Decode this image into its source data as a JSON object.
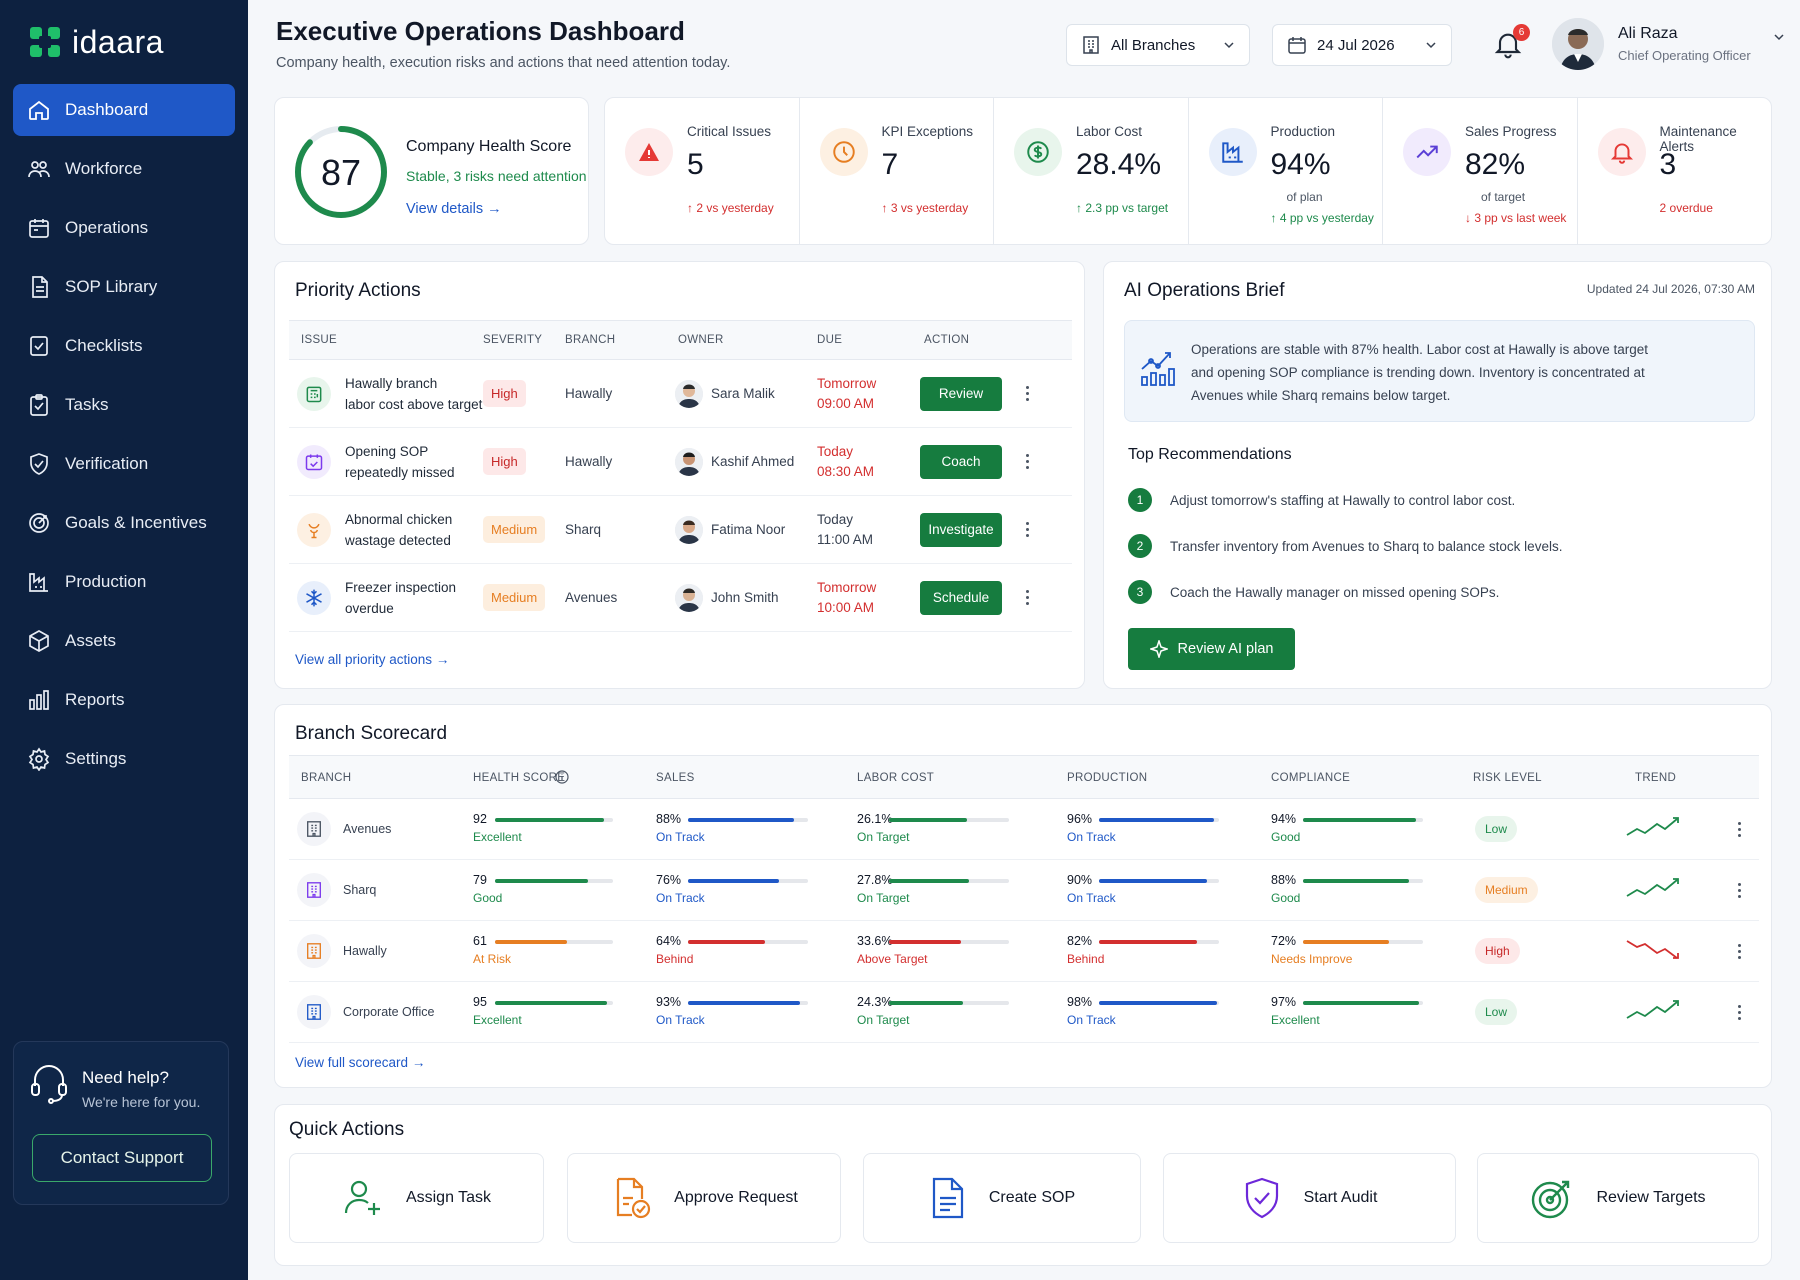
{
  "brand": {
    "name": "idaara"
  },
  "nav": [
    {
      "label": "Dashboard",
      "icon": "home-icon"
    },
    {
      "label": "Workforce",
      "icon": "people-icon"
    },
    {
      "label": "Operations",
      "icon": "calendar-icon"
    },
    {
      "label": "SOP Library",
      "icon": "document-icon"
    },
    {
      "label": "Checklists",
      "icon": "checklist-icon"
    },
    {
      "label": "Tasks",
      "icon": "clipboard-icon"
    },
    {
      "label": "Verification",
      "icon": "shield-check-icon"
    },
    {
      "label": "Goals & Incentives",
      "icon": "target-icon"
    },
    {
      "label": "Production",
      "icon": "factory-icon"
    },
    {
      "label": "Assets",
      "icon": "cube-icon"
    },
    {
      "label": "Reports",
      "icon": "bar-chart-icon"
    },
    {
      "label": "Settings",
      "icon": "gear-icon"
    }
  ],
  "help": {
    "title": "Need help?",
    "subtitle": "We're here for you.",
    "button": "Contact Support"
  },
  "header": {
    "title": "Executive Operations Dashboard",
    "subtitle": "Company health, execution risks and actions that need attention today.",
    "branch_select": "All Branches",
    "date_select": "24 Jul 2026",
    "notification_count": "6",
    "user_name": "Ali Raza",
    "user_role": "Chief Operating Officer"
  },
  "health": {
    "score": "87",
    "score_value": 87,
    "title": "Company Health Score",
    "status": "Stable, 3 risks need attention",
    "link": "View details"
  },
  "kpis": [
    {
      "label": "Critical Issues",
      "value": "5",
      "sub": "",
      "delta_num": "2",
      "delta_text": "vs yesterday",
      "dir": "up",
      "tone": "red",
      "icon": "warning-icon"
    },
    {
      "label": "KPI Exceptions",
      "value": "7",
      "sub": "",
      "delta_num": "3",
      "delta_text": "vs yesterday",
      "dir": "up",
      "tone": "red",
      "icon": "clock-icon"
    },
    {
      "label": "Labor Cost",
      "value": "28.4%",
      "sub": "",
      "delta_num": "2.3",
      "delta_text": "pp vs target",
      "dir": "up",
      "tone": "green",
      "icon": "dollar-icon"
    },
    {
      "label": "Production",
      "value": "94%",
      "sub": "of plan",
      "delta_num": "4",
      "delta_text": "pp vs yesterday",
      "dir": "up",
      "tone": "green",
      "icon": "factory-icon"
    },
    {
      "label": "Sales Progress",
      "value": "82%",
      "sub": "of target",
      "delta_num": "3",
      "delta_text": "pp vs last week",
      "dir": "down",
      "tone": "red",
      "icon": "trend-up-icon"
    },
    {
      "label": "Maintenance Alerts",
      "value": "3",
      "sub": "",
      "delta_num": "2",
      "delta_text": "overdue",
      "dir": "none",
      "tone": "red",
      "icon": "bell-alert-icon"
    }
  ],
  "priority": {
    "title": "Priority Actions",
    "headers": [
      "ISSUE",
      "SEVERITY",
      "BRANCH",
      "OWNER",
      "DUE",
      "ACTION"
    ],
    "rows": [
      {
        "issue_line1": "Hawally branch",
        "issue_line2": "labor cost above target",
        "severity": "High",
        "branch": "Hawally",
        "owner": "Sara Malik",
        "due_line1": "Tomorrow",
        "due_line2": "09:00 AM",
        "due_urgent": true,
        "action": "Review",
        "icon": "cash-register-icon",
        "icon_color": "#1e8a4c"
      },
      {
        "issue_line1": "Opening SOP",
        "issue_line2": "repeatedly missed",
        "severity": "High",
        "branch": "Hawally",
        "owner": "Kashif Ahmed",
        "due_line1": "Today",
        "due_line2": "08:30 AM",
        "due_urgent": true,
        "action": "Coach",
        "icon": "calendar-check-icon",
        "icon_color": "#7c3aed"
      },
      {
        "issue_line1": "Abnormal chicken",
        "issue_line2": "wastage detected",
        "severity": "Medium",
        "branch": "Sharq",
        "owner": "Fatima Noor",
        "due_line1": "Today",
        "due_line2": "11:00 AM",
        "due_urgent": false,
        "action": "Investigate",
        "icon": "chicken-icon",
        "icon_color": "#e67e22"
      },
      {
        "issue_line1": "Freezer inspection",
        "issue_line2": "overdue",
        "severity": "Medium",
        "branch": "Avenues",
        "owner": "John Smith",
        "due_line1": "Tomorrow",
        "due_line2": "10:00 AM",
        "due_urgent": true,
        "action": "Schedule",
        "icon": "snowflake-icon",
        "icon_color": "#1f58c7"
      }
    ],
    "link": "View all priority actions"
  },
  "brief": {
    "title": "AI Operations Brief",
    "updated": "Updated 24 Jul 2026, 07:30 AM",
    "text": "Operations are stable with 87% health. Labor cost at Hawally is above target and opening SOP compliance is trending down. Inventory is concentrated at Avenues while Sharq remains below target.",
    "rec_title": "Top Recommendations",
    "recs": [
      "Adjust tomorrow's staffing at Hawally to control labor cost.",
      "Transfer inventory from Avenues to Sharq to balance stock levels.",
      "Coach the Hawally manager on missed opening SOPs."
    ],
    "button": "Review AI plan"
  },
  "scorecard": {
    "title": "Branch Scorecard",
    "headers": [
      "BRANCH",
      "HEALTH SCORE",
      "SALES",
      "LABOR COST",
      "PRODUCTION",
      "COMPLIANCE",
      "RISK LEVEL",
      "TREND"
    ],
    "rows": [
      {
        "branch": "Avenues",
        "icon_color": "#4b5563",
        "health": "92",
        "health_pct": 92,
        "health_status": "Excellent",
        "health_tone": "green",
        "sales": "88%",
        "sales_pct": 88,
        "sales_status": "On Track",
        "sales_tone": "blue",
        "labor": "26.1%",
        "labor_pct": 65,
        "labor_status": "On Target",
        "labor_tone": "green",
        "prod": "96%",
        "prod_pct": 96,
        "prod_status": "On Track",
        "prod_tone": "blue",
        "comp": "94%",
        "comp_pct": 94,
        "comp_status": "Good",
        "comp_tone": "green",
        "risk": "Low",
        "risk_class": "risk-low",
        "trend": "up"
      },
      {
        "branch": "Sharq",
        "icon_color": "#7c3aed",
        "health": "79",
        "health_pct": 79,
        "health_status": "Good",
        "health_tone": "green",
        "sales": "76%",
        "sales_pct": 76,
        "sales_status": "On Track",
        "sales_tone": "blue",
        "labor": "27.8%",
        "labor_pct": 67,
        "labor_status": "On Target",
        "labor_tone": "green",
        "prod": "90%",
        "prod_pct": 90,
        "prod_status": "On Track",
        "prod_tone": "blue",
        "comp": "88%",
        "comp_pct": 88,
        "comp_status": "Good",
        "comp_tone": "green",
        "risk": "Medium",
        "risk_class": "risk-med",
        "trend": "up"
      },
      {
        "branch": "Hawally",
        "icon_color": "#e67e22",
        "health": "61",
        "health_pct": 61,
        "health_status": "At Risk",
        "health_tone": "orange",
        "sales": "64%",
        "sales_pct": 64,
        "sales_status": "Behind",
        "sales_tone": "red",
        "labor": "33.6%",
        "labor_pct": 60,
        "labor_status": "Above Target",
        "labor_tone": "red",
        "prod": "82%",
        "prod_pct": 82,
        "prod_status": "Behind",
        "prod_tone": "red",
        "comp": "72%",
        "comp_pct": 72,
        "comp_status": "Needs Improve",
        "comp_tone": "orange",
        "risk": "High",
        "risk_class": "risk-high",
        "trend": "down"
      },
      {
        "branch": "Corporate Office",
        "icon_color": "#1f58c7",
        "health": "95",
        "health_pct": 95,
        "health_status": "Excellent",
        "health_tone": "green",
        "sales": "93%",
        "sales_pct": 93,
        "sales_status": "On Track",
        "sales_tone": "blue",
        "labor": "24.3%",
        "labor_pct": 62,
        "labor_status": "On Target",
        "labor_tone": "green",
        "prod": "98%",
        "prod_pct": 98,
        "prod_status": "On Track",
        "prod_tone": "blue",
        "comp": "97%",
        "comp_pct": 97,
        "comp_status": "Excellent",
        "comp_tone": "green",
        "risk": "Low",
        "risk_class": "risk-low",
        "trend": "up"
      }
    ],
    "link": "View full scorecard"
  },
  "quick": {
    "title": "Quick Actions",
    "items": [
      {
        "label": "Assign Task",
        "icon": "assign-user-icon"
      },
      {
        "label": "Approve Request",
        "icon": "approve-document-icon"
      },
      {
        "label": "Create SOP",
        "icon": "create-document-icon"
      },
      {
        "label": "Start Audit",
        "icon": "audit-shield-icon"
      },
      {
        "label": "Review Targets",
        "icon": "target-icon"
      }
    ]
  },
  "colors": {
    "sidebar": "#0d2140",
    "accent_blue": "#1f58c7",
    "accent_green": "#167c3f",
    "danger": "#d32f2f",
    "warning": "#e67e22"
  }
}
